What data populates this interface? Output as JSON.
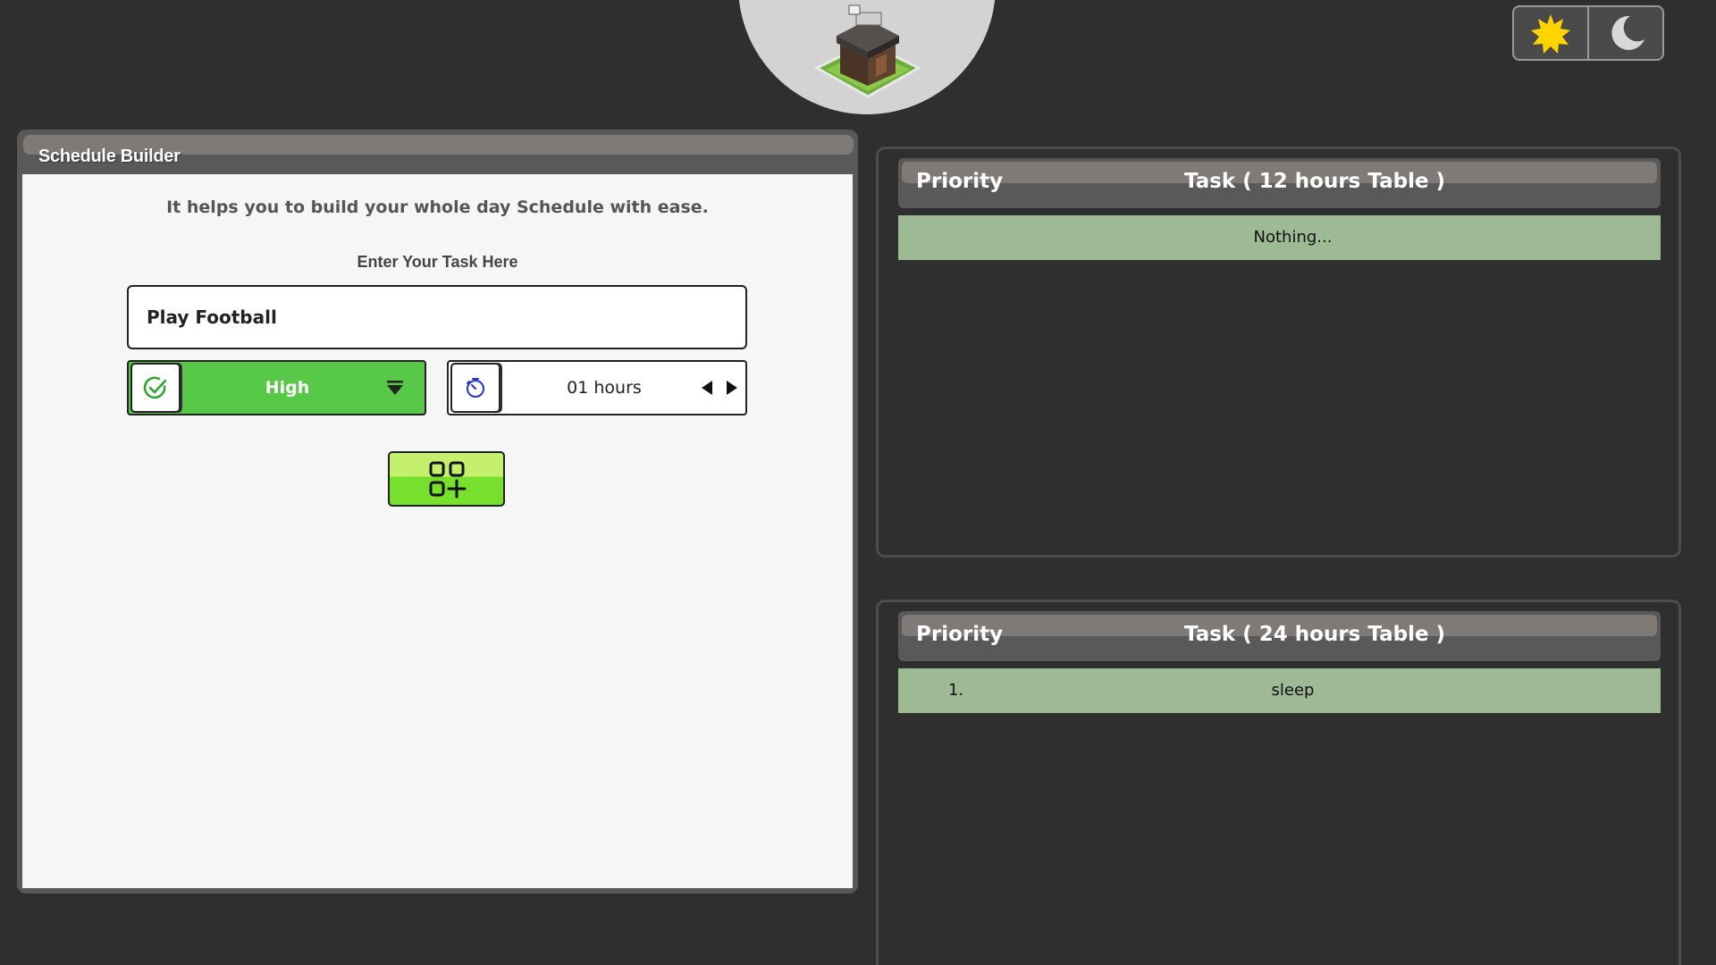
{
  "theme_toggle": {
    "light_icon": "sun-icon",
    "dark_icon": "moon-icon",
    "sun_color": "#ffd400",
    "moon_color": "#d8d8d8"
  },
  "logo": {
    "icon": "builder-hut-icon"
  },
  "builder": {
    "title": "Schedule Builder",
    "tagline": "It helps you to build your whole day Schedule with ease.",
    "task_label": "Enter Your Task Here",
    "task_value": "Play Football",
    "priority": {
      "icon": "check-circle-icon",
      "value": "High",
      "caret_icon": "caret-down-icon",
      "color": "#58c848"
    },
    "hours": {
      "icon": "timer-icon",
      "value": "01 hours",
      "prev_icon": "arrow-left-icon",
      "next_icon": "arrow-right-icon"
    },
    "add_button": {
      "icon": "add-grid-icon"
    }
  },
  "table_12": {
    "col_priority": "Priority",
    "col_task": "Task ( 12 hours Table )",
    "empty_text": "Nothing..."
  },
  "table_24": {
    "col_priority": "Priority",
    "col_task": "Task ( 24 hours Table )",
    "rows": [
      {
        "num": "1.",
        "task": "sleep"
      }
    ]
  },
  "colors": {
    "background": "#2f2f2f",
    "panel": "#595959",
    "row": "#9eba95",
    "accent_green": "#76e02c"
  }
}
